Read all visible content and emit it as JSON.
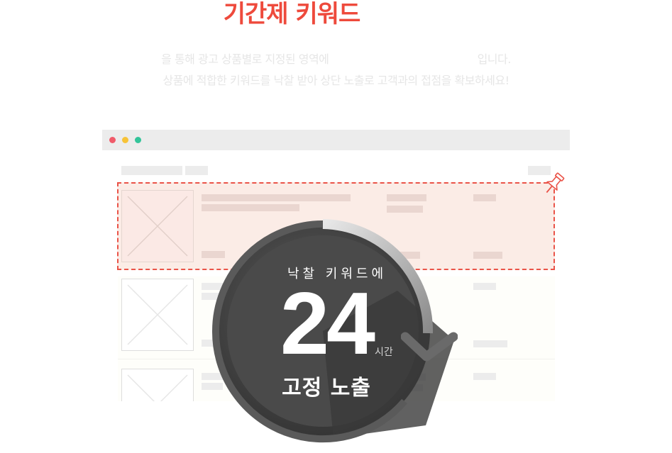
{
  "header": {
    "title": "기간제 키워드",
    "line1_part1": "을 통해 광고 상품별로 지정된 영역에",
    "line1_part2": "입니다.",
    "line2": "상품에 적합한 키워드를 낙찰 받아 상단 노출로 고객과의 접점을 확보하세요!"
  },
  "badge": {
    "top_text": "낙찰 키워드에",
    "number": "24",
    "unit": "시간",
    "bottom_text": "고정 노출"
  },
  "colors": {
    "accent": "#ee4a3c",
    "highlight_border": "#ea5348",
    "highlight_fill": "#fbece6",
    "badge_dark": "#4a4a4a"
  },
  "icons": {
    "pin": "pushpin-icon",
    "refresh": "circular-arrow-icon"
  }
}
